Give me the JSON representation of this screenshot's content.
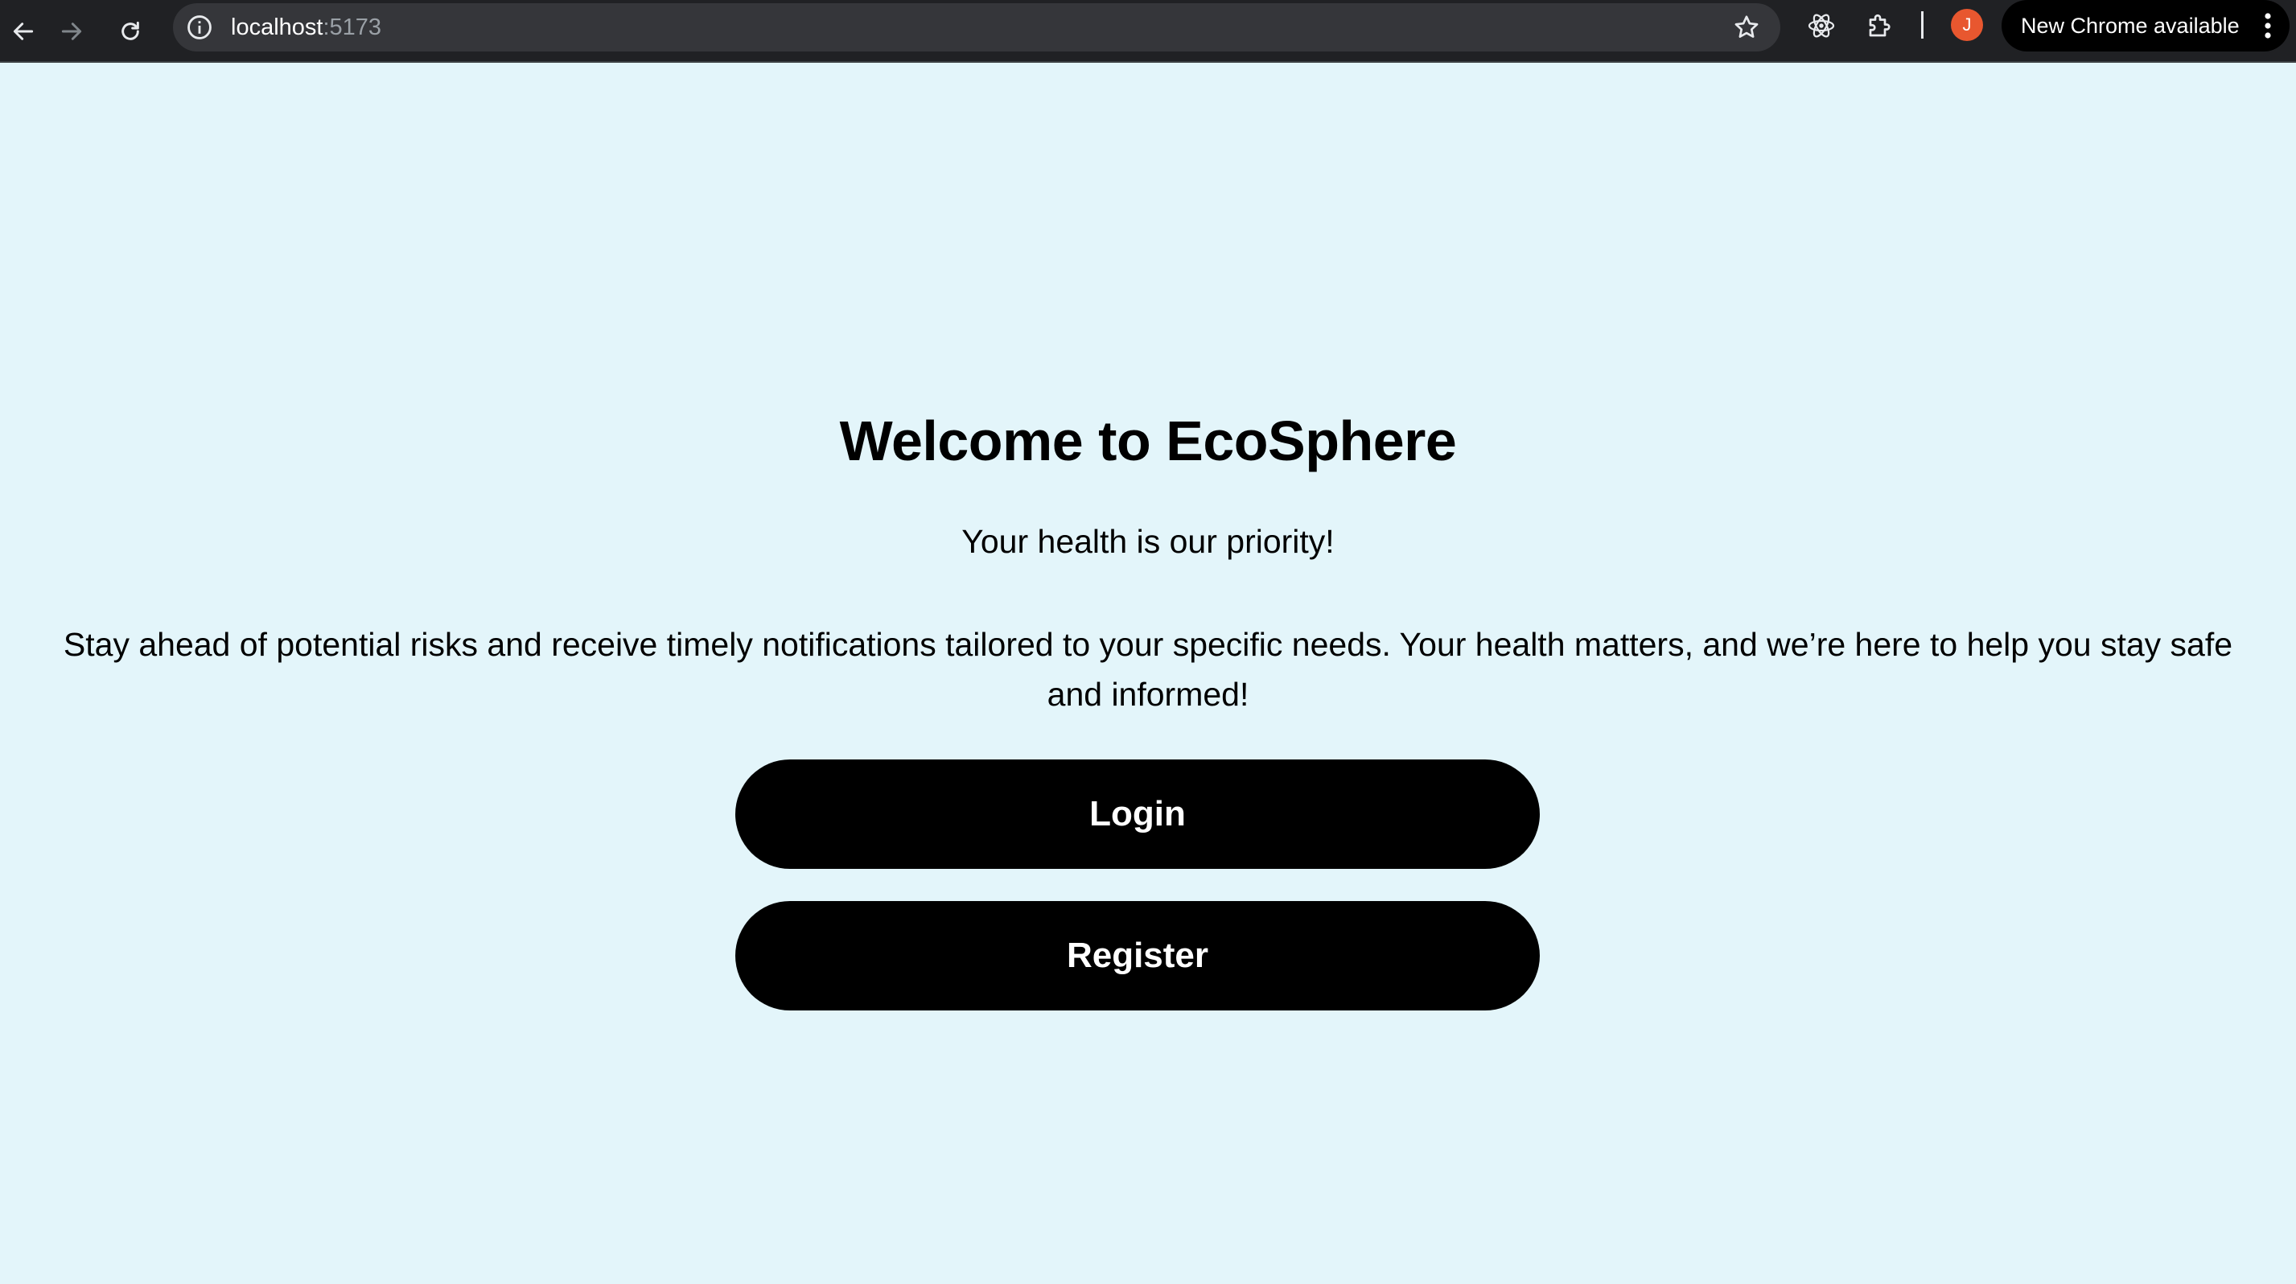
{
  "browser": {
    "url_host": "localhost",
    "url_port": ":5173",
    "avatar_initial": "J",
    "update_chip_label": "New Chrome available",
    "icons": {
      "back": "back-arrow-icon",
      "forward": "forward-arrow-icon",
      "reload": "reload-icon",
      "site_info": "info-icon",
      "bookmark": "star-icon",
      "react_devtools": "atom-icon",
      "extensions": "puzzle-icon",
      "menu": "kebab-menu-icon"
    }
  },
  "page": {
    "title": "Welcome to EcoSphere",
    "subtitle": "Your health is our priority!",
    "description": "Stay ahead of potential risks and receive timely notifications tailored to your specific needs. Your health matters, and we’re here to help you stay safe and informed!",
    "login_label": "Login",
    "register_label": "Register"
  },
  "colors": {
    "page_background": "#e3f5fa",
    "button_background": "#000000",
    "button_text": "#ffffff",
    "toolbar_background": "#202124",
    "avatar_background": "#e8572f"
  }
}
